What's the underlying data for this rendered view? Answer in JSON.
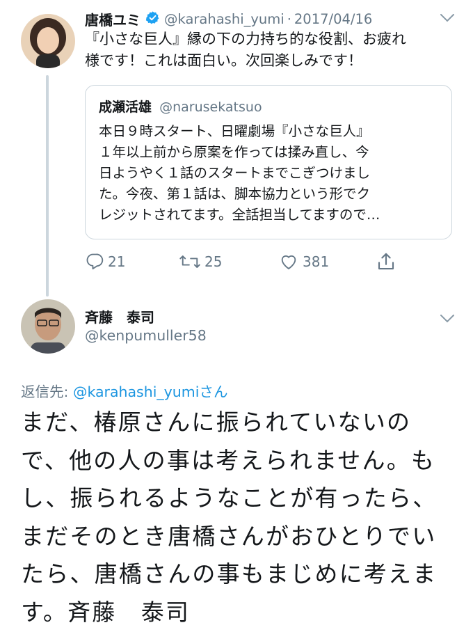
{
  "colors": {
    "accent": "#1da1f2",
    "link": "#1b95e0",
    "muted": "#657786",
    "border": "#ccd6dd"
  },
  "parent_tweet": {
    "display_name": "唐橋ユミ",
    "verified_icon": "verified-badge-icon",
    "handle": "@karahashi_yumi",
    "date": "2017/04/16",
    "text_lines": [
      "『小さな巨人』縁の下の力持ち的な役割、お疲れ",
      "様です！これは面白い。次回楽しみです！"
    ],
    "quoted": {
      "display_name": "成瀬活雄",
      "handle": "@narusekatsuo",
      "text_lines": [
        "本日９時スタート、日曜劇場『小さな巨人』",
        "１年以上前から原案を作っては揉み直し、今",
        "日ようやく１話のスタートまでこぎつけまし",
        "た。今夜、第１話は、脚本協力という形でク",
        "レジットされてます。全話担当してますので…"
      ]
    },
    "actions": {
      "replies": "21",
      "retweets": "25",
      "likes": "381"
    }
  },
  "reply_tweet": {
    "display_name": "斉藤　泰司",
    "handle": "@kenpumuller58",
    "replying_to_prefix": "返信先: ",
    "replying_to_handle": "@karahashi_yumi",
    "replying_to_suffix": "さん",
    "text_lines": [
      "まだ、椿原さんに振られていないの",
      "で、他の人の事は考えられません。も",
      "し、振られるようなことが有ったら、",
      "まだそのとき唐橋さんがおひとりでい",
      "たら、唐橋さんの事もまじめに考えま",
      "す。斉藤　泰司"
    ]
  }
}
